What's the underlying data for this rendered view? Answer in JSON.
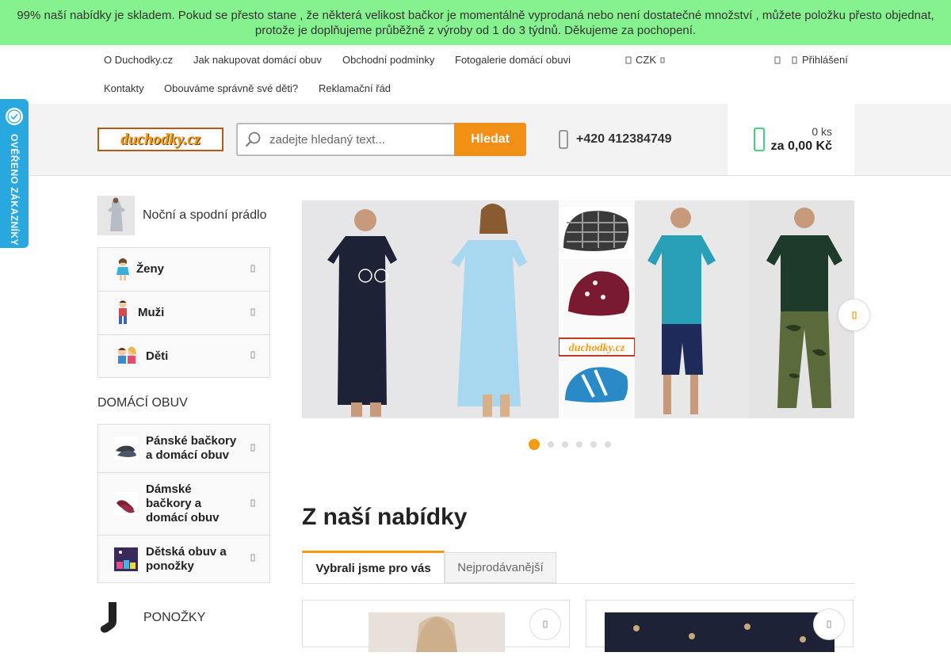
{
  "notice": {
    "line1": "99% naší nabídky je skladem. Pokud se přesto stane , že některá velikost bačkor je momentálně vyprodaná nebo není dostatečné množství , můžete položku přesto objednat,",
    "line2": "protože je doplňujeme průběžně z výroby od 1 do 3 týdnů. Děkujeme za pochopení."
  },
  "topnav": {
    "links": [
      "O Duchodky.cz",
      "Jak nakupovat domácí obuv",
      "Obchodní podmínky",
      "Fotogalerie domácí obuvi",
      "Kontakty",
      "Obouváme správně své děti?",
      "Reklamační řád"
    ],
    "currency": "CZK",
    "login": "Přihlášení",
    "icons": {
      "currency": "flag-icon",
      "login": "user-icon",
      "extra": "heart-icon"
    }
  },
  "header": {
    "logo_text": "duchodky.cz",
    "search_placeholder": "zadejte hledaný text...",
    "search_button": "Hledat",
    "phone": "+420 412384749",
    "cart_count": "0 ks",
    "cart_total": "za 0,00 Kč",
    "icons": {
      "search": "search-icon",
      "phone": "phone-icon",
      "cart": "cart-icon"
    }
  },
  "badge": {
    "text": "OVĚŘENO ZÁKAZNÍKY"
  },
  "sidebar": {
    "category_title": "Noční a spodní prádlo",
    "categories": [
      {
        "label": "Ženy"
      },
      {
        "label": "Muži"
      },
      {
        "label": "Děti"
      }
    ],
    "section_title": "DOMÁCÍ OBUV",
    "shoes": [
      {
        "label": "Pánské bačkory a domácí obuv"
      },
      {
        "label": "Dámské bačkory a domácí obuv"
      },
      {
        "label": "Dětská obuv a ponožky"
      }
    ],
    "socks_title": "PONOŽKY"
  },
  "banner": {
    "logo_text": "duchodky.cz",
    "slides_total": 6,
    "active_slide": 1
  },
  "main": {
    "title": "Z naší nabídky",
    "tabs": [
      "Vybrali jsme pro vás",
      "Nejprodávanější"
    ]
  },
  "colors": {
    "accent": "#f39c12",
    "notice_bg": "#85f28f",
    "badge_bg": "#29a8e0",
    "cart_icon": "#2ecc71"
  }
}
